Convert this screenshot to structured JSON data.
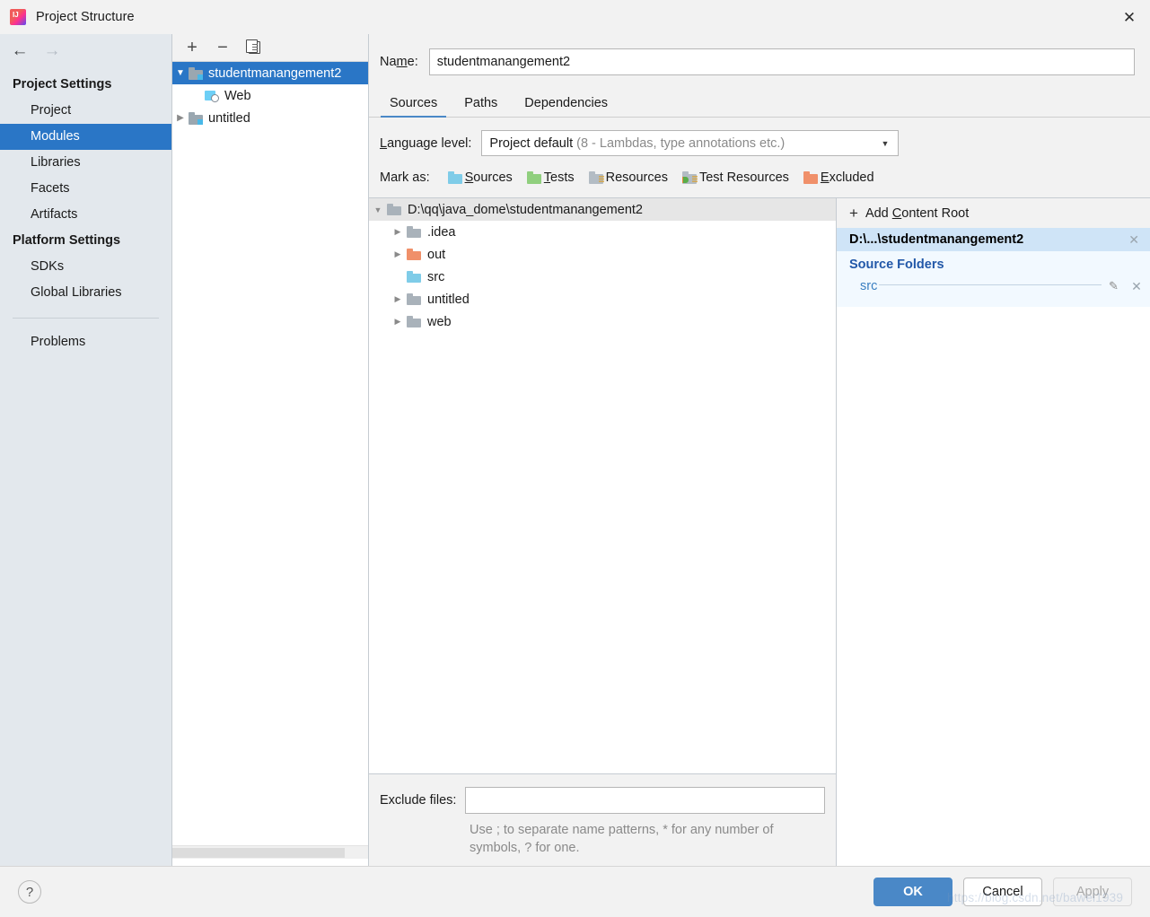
{
  "window": {
    "title": "Project Structure",
    "app_icon": "intellij-idea-logo",
    "close_label": "✕"
  },
  "nav": {
    "back_icon": "←",
    "forward_icon": "→"
  },
  "sidebar": {
    "groups": [
      {
        "title": "Project Settings",
        "items": [
          {
            "label": "Project",
            "selected": false
          },
          {
            "label": "Modules",
            "selected": true
          },
          {
            "label": "Libraries",
            "selected": false
          },
          {
            "label": "Facets",
            "selected": false
          },
          {
            "label": "Artifacts",
            "selected": false
          }
        ]
      },
      {
        "title": "Platform Settings",
        "items": [
          {
            "label": "SDKs",
            "selected": false
          },
          {
            "label": "Global Libraries",
            "selected": false
          }
        ]
      }
    ],
    "extra_items": [
      {
        "label": "Problems",
        "selected": false
      }
    ]
  },
  "modules_panel": {
    "toolbar": {
      "add_label": "+",
      "remove_label": "−",
      "copy_label": "copy-icon"
    },
    "tree": [
      {
        "label": "studentmanangement2",
        "icon": "module-folder-icon",
        "expanded": true,
        "selected": true,
        "depth": 0
      },
      {
        "label": "Web",
        "icon": "web-facet-icon",
        "expanded": null,
        "selected": false,
        "depth": 1
      },
      {
        "label": "untitled",
        "icon": "module-folder-icon",
        "expanded": false,
        "selected": false,
        "depth": 0
      }
    ]
  },
  "main": {
    "name_label": "Name:",
    "name_value": "studentmanangement2",
    "name_placeholder": "",
    "tabs": [
      {
        "label": "Sources",
        "active": true
      },
      {
        "label": "Paths",
        "active": false
      },
      {
        "label": "Dependencies",
        "active": false
      }
    ],
    "language_level": {
      "label": "Language level:",
      "value_main": "Project default",
      "value_sub": "(8 - Lambdas, type annotations etc.)",
      "arrow": "▼"
    },
    "mark_as": {
      "label": "Mark as:",
      "options": [
        {
          "label": "Sources",
          "color": "#7fcce8"
        },
        {
          "label": "Tests",
          "color": "#90cf7e"
        },
        {
          "label": "Resources",
          "color": "#b3bcc4"
        },
        {
          "label": "Test Resources",
          "color": "#b3bcc4"
        },
        {
          "label": "Excluded",
          "color": "#f0906a"
        }
      ]
    },
    "file_tree": [
      {
        "label": "D:\\qq\\java_dome\\studentmanangement2",
        "color": "#a9b2ba",
        "arrow": "open",
        "depth": 0,
        "header": true
      },
      {
        "label": ".idea",
        "color": "#a9b2ba",
        "arrow": "closed",
        "depth": 1,
        "header": false
      },
      {
        "label": "out",
        "color": "#f0906a",
        "arrow": "closed",
        "depth": 1,
        "header": false
      },
      {
        "label": "src",
        "color": "#7fcce8",
        "arrow": "none",
        "depth": 1,
        "header": false
      },
      {
        "label": "untitled",
        "color": "#a9b2ba",
        "arrow": "closed",
        "depth": 1,
        "header": false
      },
      {
        "label": "web",
        "color": "#a9b2ba",
        "arrow": "closed",
        "depth": 1,
        "header": false
      }
    ],
    "exclude": {
      "label": "Exclude files:",
      "value": "",
      "placeholder": "",
      "hint": "Use ; to separate name patterns, * for any number of symbols, ? for one."
    }
  },
  "content_roots": {
    "add_label": "Add Content Root",
    "add_icon": "+",
    "root": {
      "path": "D:\\...\\studentmanangement2",
      "close_icon": "✕"
    },
    "source_folders": {
      "title": "Source Folders",
      "entries": [
        {
          "name": "src",
          "edit_icon": "pencil-icon",
          "remove_icon": "✕"
        }
      ]
    }
  },
  "footer": {
    "help_label": "?",
    "ok_label": "OK",
    "cancel_label": "Cancel",
    "apply_label": "Apply"
  },
  "watermark": {
    "text": "https://blog.csdn.net/bawei1939"
  },
  "colors": {
    "selection_blue": "#2a76c6",
    "tab_accent": "#4a88c7",
    "ok_button": "#4a88c7",
    "root_header_bg": "#cfe4f7",
    "root_body_bg": "#f2f9ff",
    "source_folders_blue": "#2258a8",
    "src_link_blue": "#3a7fc1"
  }
}
